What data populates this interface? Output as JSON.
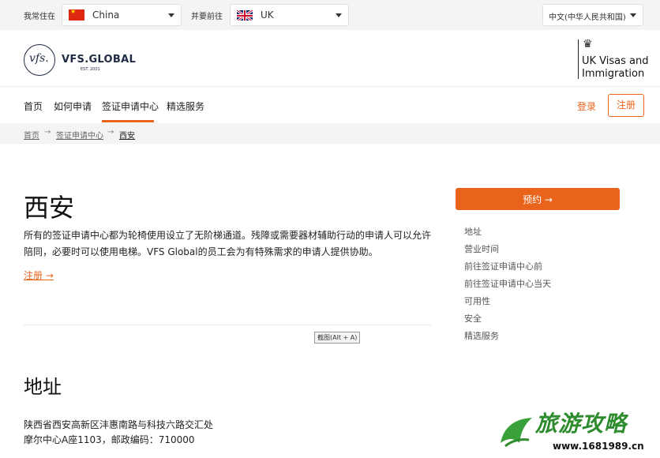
{
  "topbar": {
    "live_in_label": "我常住在",
    "live_in_value": "China",
    "go_to_label": "并要前往",
    "go_to_value": "UK",
    "language": "中文(中华人民共和国)"
  },
  "header": {
    "logo_mark": "vfs.",
    "logo_text": "VFS.GLOBAL",
    "logo_est": "EST. 2001",
    "partner_text": "UK Visas and Immigration"
  },
  "nav": {
    "items": [
      "首页",
      "如何申请",
      "签证申请中心",
      "精选服务"
    ],
    "active_index": 2,
    "login": "登录",
    "register": "注册"
  },
  "breadcrumb": {
    "items": [
      "首页",
      "签证申请中心",
      "西安"
    ],
    "separator": "→"
  },
  "main": {
    "title": "西安",
    "intro": "所有的签证申请中心都为轮椅使用设立了无阶梯通道。残障或需要器材辅助行动的申请人可以允许陪同，必要时可以使用电梯。VFS Global的员工会为有特殊需求的申请人提供协助。",
    "register_link": "注册 →",
    "tooltip": "截图(Alt + A)",
    "address_title": "地址",
    "address_line1": "陕西省西安高新区沣惠南路与科技六路交汇处",
    "address_line2": "摩尔中心A座1103，邮政编码：710000"
  },
  "sidebar": {
    "book_button": "预约 →",
    "links": [
      "地址",
      "营业时间",
      "前往签证申请中心前",
      "前往签证申请中心当天",
      "可用性",
      "安全",
      "精选服务"
    ]
  },
  "watermark": {
    "title": "旅游攻略",
    "url": "www.1681989.cn"
  },
  "colors": {
    "accent": "#e9631b",
    "navy": "#1f2a44",
    "topbar_bg": "#f3f4f5",
    "watermark_green": "#2e8b2e"
  }
}
